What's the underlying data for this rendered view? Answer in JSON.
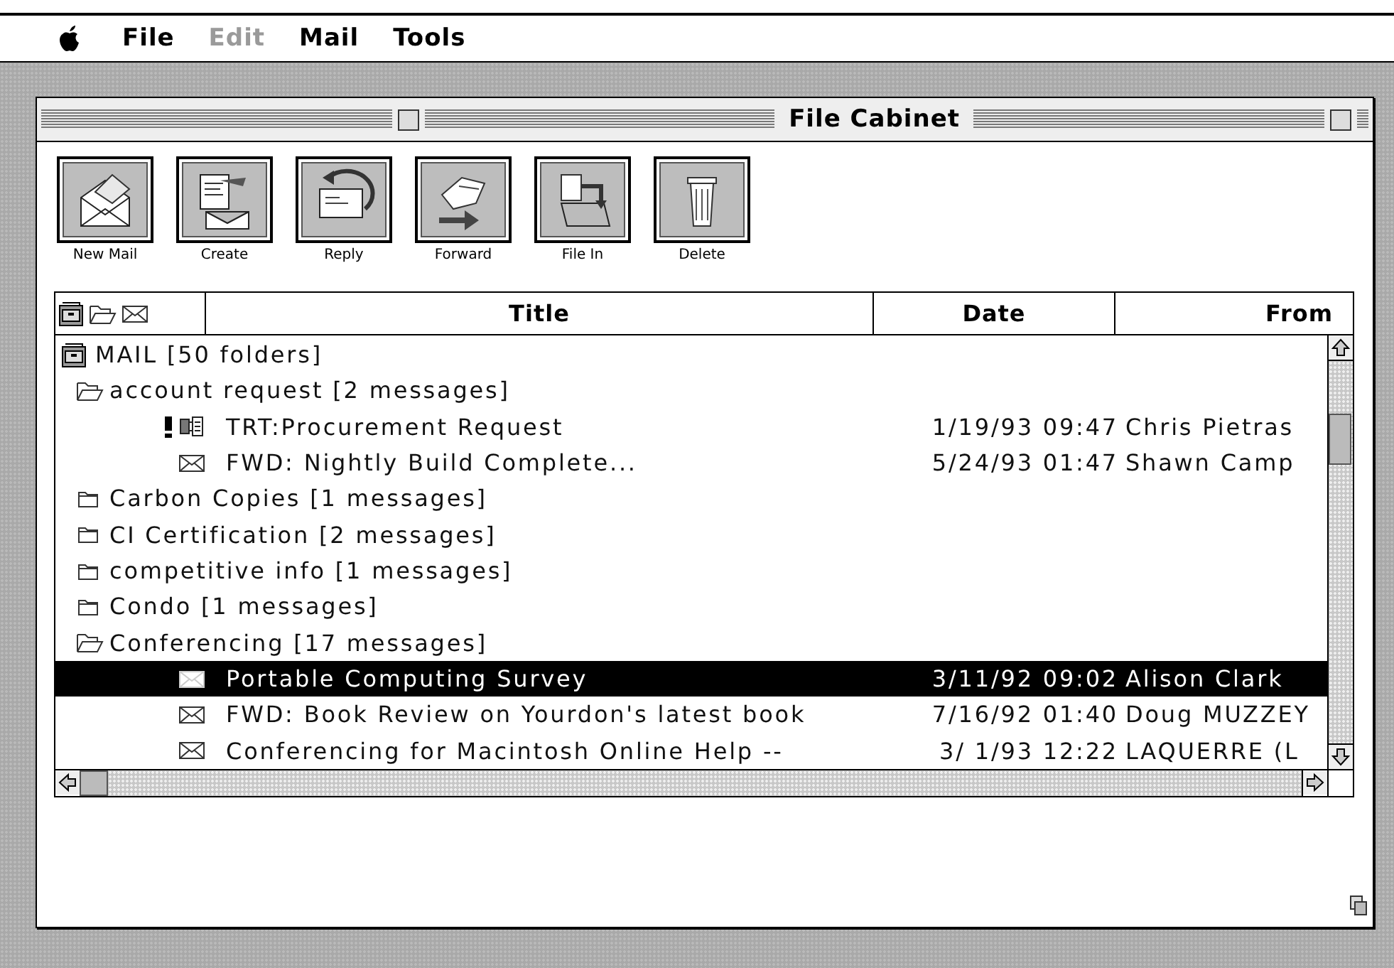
{
  "menu_bar": {
    "items": [
      {
        "label": "File",
        "disabled": false
      },
      {
        "label": "Edit",
        "disabled": true
      },
      {
        "label": "Mail",
        "disabled": false
      },
      {
        "label": "Tools",
        "disabled": false
      }
    ]
  },
  "window": {
    "title": "File Cabinet"
  },
  "toolbar": {
    "buttons": [
      {
        "label": "New Mail"
      },
      {
        "label": "Create"
      },
      {
        "label": "Reply"
      },
      {
        "label": "Forward"
      },
      {
        "label": "File In"
      },
      {
        "label": "Delete"
      }
    ]
  },
  "table": {
    "columns": [
      "Title",
      "Date",
      "From"
    ],
    "tree": [
      {
        "kind": "cabinet",
        "title": "MAIL  [50 folders]",
        "selected": false,
        "children": [
          {
            "kind": "folder",
            "title": "account request  [2 messages]",
            "selected": false,
            "expanded": true,
            "children": [
              {
                "kind": "form",
                "title": "TRT:Procurement Request",
                "date": "1/19/93 09:47",
                "from": "Chris Pietras",
                "flagged": true,
                "selected": false
              },
              {
                "kind": "mail",
                "title": "FWD: Nightly Build Complete...",
                "date": "5/24/93 01:47",
                "from": "Shawn Camp",
                "flagged": false,
                "selected": false
              }
            ]
          },
          {
            "kind": "folder",
            "title": "Carbon Copies  [1 messages]",
            "selected": false,
            "expanded": false
          },
          {
            "kind": "folder",
            "title": "CI Certification  [2 messages]",
            "selected": false,
            "expanded": false
          },
          {
            "kind": "folder",
            "title": "competitive info  [1 messages]",
            "selected": false,
            "expanded": false
          },
          {
            "kind": "folder",
            "title": "Condo  [1 messages]",
            "selected": false,
            "expanded": false
          },
          {
            "kind": "folder",
            "title": "Conferencing  [17 messages]",
            "selected": false,
            "expanded": true,
            "children": [
              {
                "kind": "mail",
                "title": "Portable Computing Survey",
                "date": "3/11/92 09:02",
                "from": "Alison Clark",
                "flagged": false,
                "selected": true
              },
              {
                "kind": "mail",
                "title": "FWD: Book Review on Yourdon's latest book",
                "date": "7/16/92 01:40",
                "from": "Doug MUZZEY",
                "flagged": false,
                "selected": false
              },
              {
                "kind": "mail",
                "title": "Conferencing for Macintosh Online Help --",
                "date": "3/ 1/93 12:22",
                "from": "LAQUERRE (L",
                "flagged": false,
                "selected": false
              }
            ]
          }
        ]
      }
    ]
  }
}
